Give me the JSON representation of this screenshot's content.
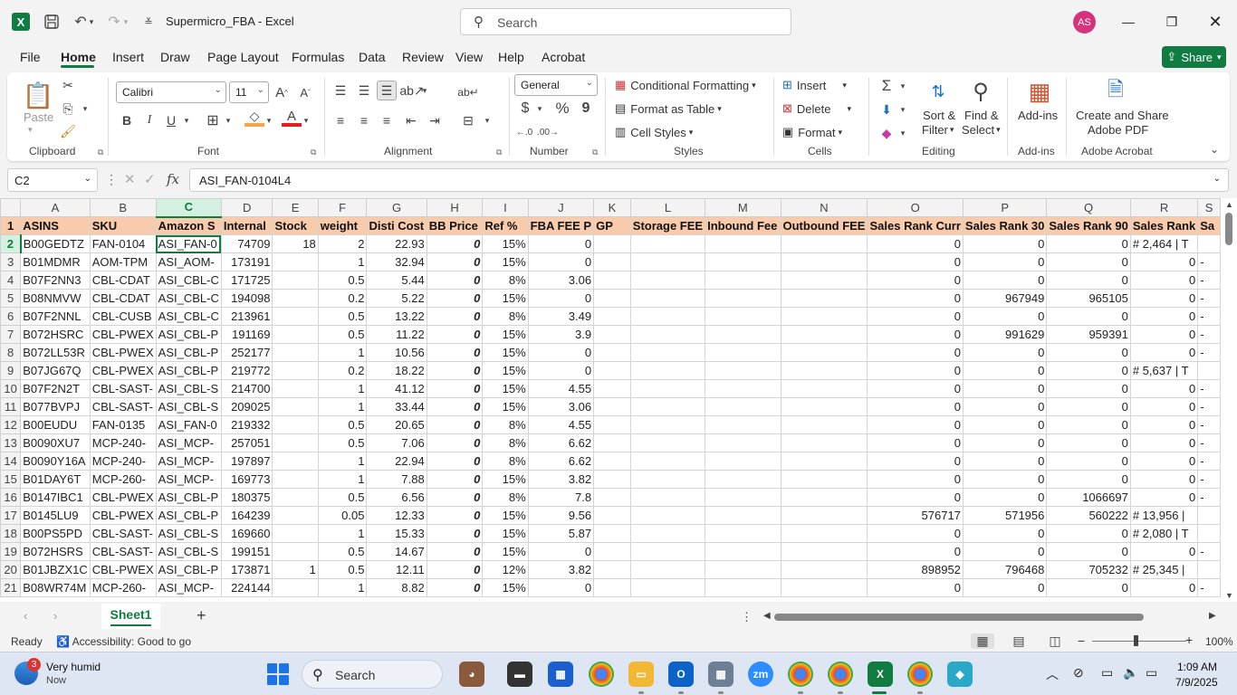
{
  "titlebar": {
    "app_logo": "X",
    "doc_title": "Supermicro_FBA  -  Excel",
    "search_placeholder": "Search",
    "avatar_initials": "AS",
    "icons": [
      "save-icon",
      "undo-icon",
      "redo-icon",
      "customize-qat-icon",
      "minimize-icon",
      "maximize-icon",
      "close-icon"
    ]
  },
  "menu": {
    "tabs": [
      "File",
      "Home",
      "Insert",
      "Draw",
      "Page Layout",
      "Formulas",
      "Data",
      "Review",
      "View",
      "Help",
      "Acrobat"
    ],
    "active": "Home",
    "share_label": "Share"
  },
  "ribbon": {
    "clipboard": {
      "paste": "Paste",
      "label": "Clipboard"
    },
    "font": {
      "name": "Calibri",
      "size": "11",
      "bold": "B",
      "italic": "I",
      "underline": "U",
      "label": "Font"
    },
    "alignment": {
      "label": "Alignment"
    },
    "number": {
      "format": "General",
      "currency": "$",
      "percent": "%",
      "comma": "9",
      "label": "Number"
    },
    "styles": {
      "conditional": "Conditional Formatting",
      "format_table": "Format as Table",
      "cell_styles": "Cell Styles",
      "label": "Styles"
    },
    "cells": {
      "insert": "Insert",
      "delete": "Delete",
      "format": "Format",
      "label": "Cells"
    },
    "editing": {
      "sort1": "Sort &",
      "sort2": "Filter",
      "find1": "Find &",
      "find2": "Select",
      "label": "Editing"
    },
    "addins": {
      "btn": "Add-ins",
      "label": "Add-ins"
    },
    "acrobat": {
      "btn1": "Create and Share",
      "btn2": "Adobe PDF",
      "label": "Adobe Acrobat"
    }
  },
  "formula_bar": {
    "name_box": "C2",
    "fx": "fx",
    "value": "ASI_FAN-0104L4"
  },
  "sheet": {
    "columns": [
      "A",
      "B",
      "C",
      "D",
      "E",
      "F",
      "G",
      "H",
      "I",
      "J",
      "K",
      "L",
      "M",
      "N",
      "O",
      "P",
      "Q",
      "R",
      "S"
    ],
    "headers": [
      "ASINS",
      "SKU",
      "Amazon S",
      "Internal",
      "Stock",
      "weight",
      "Disti Cost",
      "BB Price",
      "Ref %",
      "FBA FEE P",
      "GP",
      "Storage FEE",
      "Inbound Fee",
      "Outbound FEE",
      "Sales Rank Curr",
      "Sales Rank 30",
      "Sales Rank 90",
      "Sales Rank",
      "Sa"
    ],
    "rows": [
      {
        "n": "2",
        "c": [
          "B00GEDTZ",
          "FAN-0104",
          "ASI_FAN-0",
          "74709",
          "18",
          "2",
          "22.93",
          "0",
          "15%",
          "0",
          "",
          "",
          "",
          "",
          "0",
          "0",
          "0",
          "# 2,464  |  T",
          ""
        ]
      },
      {
        "n": "3",
        "c": [
          "B01MDMR",
          "AOM-TPM",
          "ASI_AOM-",
          "173191",
          "",
          "1",
          "32.94",
          "0",
          "15%",
          "0",
          "",
          "",
          "",
          "",
          "0",
          "0",
          "0",
          "0",
          "-"
        ]
      },
      {
        "n": "4",
        "c": [
          "B07F2NN3",
          "CBL-CDAT",
          "ASI_CBL-C",
          "171725",
          "",
          "0.5",
          "5.44",
          "0",
          "8%",
          "3.06",
          "",
          "",
          "",
          "",
          "0",
          "0",
          "0",
          "0",
          "-"
        ]
      },
      {
        "n": "5",
        "c": [
          "B08NMVW",
          "CBL-CDAT",
          "ASI_CBL-C",
          "194098",
          "",
          "0.2",
          "5.22",
          "0",
          "15%",
          "0",
          "",
          "",
          "",
          "",
          "0",
          "967949",
          "965105",
          "0",
          "-"
        ]
      },
      {
        "n": "6",
        "c": [
          "B07F2NNL",
          "CBL-CUSB",
          "ASI_CBL-C",
          "213961",
          "",
          "0.5",
          "13.22",
          "0",
          "8%",
          "3.49",
          "",
          "",
          "",
          "",
          "0",
          "0",
          "0",
          "0",
          "-"
        ]
      },
      {
        "n": "7",
        "c": [
          "B072HSRC",
          "CBL-PWEX",
          "ASI_CBL-P",
          "191169",
          "",
          "0.5",
          "11.22",
          "0",
          "15%",
          "3.9",
          "",
          "",
          "",
          "",
          "0",
          "991629",
          "959391",
          "0",
          "-"
        ]
      },
      {
        "n": "8",
        "c": [
          "B072LL53R",
          "CBL-PWEX",
          "ASI_CBL-P",
          "252177",
          "",
          "1",
          "10.56",
          "0",
          "15%",
          "0",
          "",
          "",
          "",
          "",
          "0",
          "0",
          "0",
          "0",
          "-"
        ]
      },
      {
        "n": "9",
        "c": [
          "B07JG67Q",
          "CBL-PWEX",
          "ASI_CBL-P",
          "219772",
          "",
          "0.2",
          "18.22",
          "0",
          "15%",
          "0",
          "",
          "",
          "",
          "",
          "0",
          "0",
          "0",
          "# 5,637  |  T",
          ""
        ]
      },
      {
        "n": "10",
        "c": [
          "B07F2N2T",
          "CBL-SAST-",
          "ASI_CBL-S",
          "214700",
          "",
          "1",
          "41.12",
          "0",
          "15%",
          "4.55",
          "",
          "",
          "",
          "",
          "0",
          "0",
          "0",
          "0",
          "-"
        ]
      },
      {
        "n": "11",
        "c": [
          "B077BVPJ",
          "CBL-SAST-",
          "ASI_CBL-S",
          "209025",
          "",
          "1",
          "33.44",
          "0",
          "15%",
          "3.06",
          "",
          "",
          "",
          "",
          "0",
          "0",
          "0",
          "0",
          "-"
        ]
      },
      {
        "n": "12",
        "c": [
          "B00EUDU",
          "FAN-0135",
          "ASI_FAN-0",
          "219332",
          "",
          "0.5",
          "20.65",
          "0",
          "8%",
          "4.55",
          "",
          "",
          "",
          "",
          "0",
          "0",
          "0",
          "0",
          "-"
        ]
      },
      {
        "n": "13",
        "c": [
          "B0090XU7",
          "MCP-240-",
          "ASI_MCP-",
          "257051",
          "",
          "0.5",
          "7.06",
          "0",
          "8%",
          "6.62",
          "",
          "",
          "",
          "",
          "0",
          "0",
          "0",
          "0",
          "-"
        ]
      },
      {
        "n": "14",
        "c": [
          "B0090Y16A",
          "MCP-240-",
          "ASI_MCP-",
          "197897",
          "",
          "1",
          "22.94",
          "0",
          "8%",
          "6.62",
          "",
          "",
          "",
          "",
          "0",
          "0",
          "0",
          "0",
          "-"
        ]
      },
      {
        "n": "15",
        "c": [
          "B01DAY6T",
          "MCP-260-",
          "ASI_MCP-",
          "169773",
          "",
          "1",
          "7.88",
          "0",
          "15%",
          "3.82",
          "",
          "",
          "",
          "",
          "0",
          "0",
          "0",
          "0",
          "-"
        ]
      },
      {
        "n": "16",
        "c": [
          "B0147IBC1",
          "CBL-PWEX",
          "ASI_CBL-P",
          "180375",
          "",
          "0.5",
          "6.56",
          "0",
          "8%",
          "7.8",
          "",
          "",
          "",
          "",
          "0",
          "0",
          "1066697",
          "0",
          "-"
        ]
      },
      {
        "n": "17",
        "c": [
          "B0145LU9",
          "CBL-PWEX",
          "ASI_CBL-P",
          "164239",
          "",
          "0.05",
          "12.33",
          "0",
          "15%",
          "9.56",
          "",
          "",
          "",
          "",
          "576717",
          "571956",
          "560222",
          "# 13,956  |",
          ""
        ]
      },
      {
        "n": "18",
        "c": [
          "B00PS5PD",
          "CBL-SAST-",
          "ASI_CBL-S",
          "169660",
          "",
          "1",
          "15.33",
          "0",
          "15%",
          "5.87",
          "",
          "",
          "",
          "",
          "0",
          "0",
          "0",
          "# 2,080  |  T",
          ""
        ]
      },
      {
        "n": "19",
        "c": [
          "B072HSRS",
          "CBL-SAST-",
          "ASI_CBL-S",
          "199151",
          "",
          "0.5",
          "14.67",
          "0",
          "15%",
          "0",
          "",
          "",
          "",
          "",
          "0",
          "0",
          "0",
          "0",
          "-"
        ]
      },
      {
        "n": "20",
        "c": [
          "B01JBZX1C",
          "CBL-PWEX",
          "ASI_CBL-P",
          "173871",
          "1",
          "0.5",
          "12.11",
          "0",
          "12%",
          "3.82",
          "",
          "",
          "",
          "",
          "898952",
          "796468",
          "705232",
          "# 25,345  |",
          ""
        ]
      },
      {
        "n": "21",
        "c": [
          "B08WR74M",
          "MCP-260-",
          "ASI_MCP-",
          "224144",
          "",
          "1",
          "8.82",
          "0",
          "15%",
          "0",
          "",
          "",
          "",
          "",
          "0",
          "0",
          "0",
          "0",
          "-"
        ]
      }
    ]
  },
  "tabs_bar": {
    "sheet_name": "Sheet1",
    "add": "+"
  },
  "status": {
    "ready": "Ready",
    "accessibility": "Accessibility: Good to go",
    "zoom": "100%"
  },
  "taskbar": {
    "weather_badge": "3",
    "weather_title": "Very humid",
    "weather_sub": "Now",
    "search": "Search",
    "time": "1:09 AM",
    "date": "7/9/2025"
  }
}
